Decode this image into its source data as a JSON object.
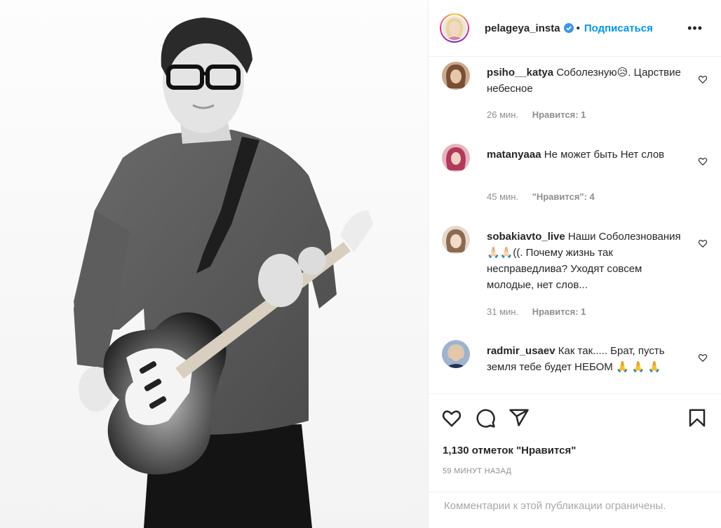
{
  "post": {
    "author": {
      "username": "pelageya_insta",
      "verified": true,
      "follow_label": "Подписаться",
      "separator": "•",
      "more_icon": "more-horizontal-icon"
    },
    "photo": {
      "description_icon": "photo"
    },
    "comments": [
      {
        "username": "psiho__katya",
        "text": "Соболезную😥. Царствие небесное",
        "time": "26 мин.",
        "likes": "Нравится: 1"
      },
      {
        "username": "matanyaaa",
        "text": "Не может быть Нет слов",
        "time": "45 мин.",
        "likes": "\"Нравится\": 4"
      },
      {
        "username": "sobakiavto_live",
        "text": "Наши Соболезнования 🙏🏻🙏🏻((. Почему жизнь так несправедлива? Уходят совсем молодые, нет слов...",
        "time": "31 мин.",
        "likes": "Нравится: 1"
      },
      {
        "username": "radmir_usaev",
        "text": "Как так..... Брат, пусть земля тебе будет НЕБОМ 🙏 🙏 🙏",
        "time": "",
        "likes": ""
      }
    ],
    "actions": {
      "like_icon": "heart-icon",
      "comment_icon": "comment-icon",
      "share_icon": "share-icon",
      "save_icon": "bookmark-icon"
    },
    "likes_count": "1,130 отметок \"Нравится\"",
    "time_ago": "59 МИНУТ НАЗАД",
    "comments_restricted": "Комментарии к этой публикации ограничены."
  }
}
